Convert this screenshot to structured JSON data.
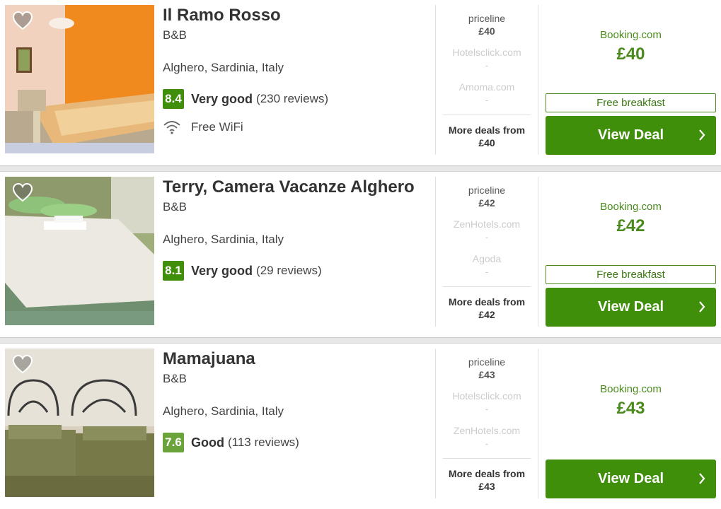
{
  "hotels": [
    {
      "name": "Il Ramo Rosso",
      "type": "B&B",
      "location": "Alghero, Sardinia, Italy",
      "score": "8.4",
      "score_color": "#3f8f0b",
      "rating_word": "Very good",
      "reviews": "(230 reviews)",
      "amenity": "Free WiFi",
      "main_partner": {
        "name": "priceline",
        "price": "£40"
      },
      "other_partners": [
        {
          "name": "Hotelsclick.com",
          "price": "-"
        },
        {
          "name": "Amoma.com",
          "price": "-"
        }
      ],
      "more_deals": "More deals from",
      "more_deals_price": "£40",
      "deal_site": "Booking.com",
      "deal_price": "£40",
      "breakfast": "Free breakfast",
      "button": "View Deal",
      "photo_theme": "orange-room"
    },
    {
      "name": "Terry, Camera Vacanze Alghero",
      "type": "B&B",
      "location": "Alghero, Sardinia, Italy",
      "score": "8.1",
      "score_color": "#3f8f0b",
      "rating_word": "Very good",
      "reviews": "(29 reviews)",
      "main_partner": {
        "name": "priceline",
        "price": "£42"
      },
      "other_partners": [
        {
          "name": "ZenHotels.com",
          "price": "-"
        },
        {
          "name": "Agoda",
          "price": "-"
        }
      ],
      "more_deals": "More deals from",
      "more_deals_price": "£42",
      "deal_site": "Booking.com",
      "deal_price": "£42",
      "breakfast": "Free breakfast",
      "button": "View Deal",
      "photo_theme": "white-bed"
    },
    {
      "name": "Mamajuana",
      "type": "B&B",
      "location": "Alghero, Sardinia, Italy",
      "score": "7.6",
      "score_color": "#6aa33a",
      "rating_word": "Good",
      "reviews": "(113 reviews)",
      "main_partner": {
        "name": "priceline",
        "price": "£43"
      },
      "other_partners": [
        {
          "name": "Hotelsclick.com",
          "price": "-"
        },
        {
          "name": "ZenHotels.com",
          "price": "-"
        }
      ],
      "more_deals": "More deals from",
      "more_deals_price": "£43",
      "deal_site": "Booking.com",
      "deal_price": "£43",
      "button": "View Deal",
      "photo_theme": "iron-beds"
    }
  ],
  "icons": {
    "favorite": "heart-icon",
    "wifi": "wifi-icon",
    "chevron": "chevron-right-icon"
  },
  "colors": {
    "accent": "#3f8f0b",
    "price": "#4a8a1c"
  }
}
